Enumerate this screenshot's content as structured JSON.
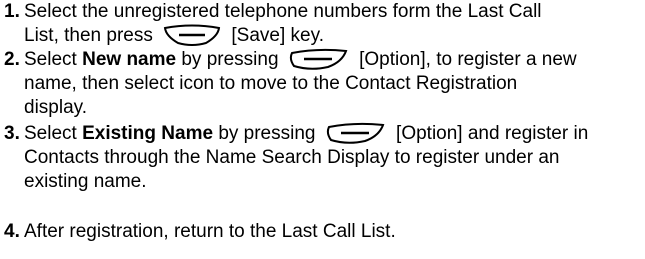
{
  "steps": [
    {
      "num": "1.",
      "l1": "Select the unregistered telephone numbers form the Last Call",
      "l2a": "List, then press",
      "l2b": "[Save] key."
    },
    {
      "num": "2.",
      "l1a": "Select",
      "l1b": "New name",
      "l1c": "by pressing",
      "l1d": "[Option], to register a new",
      "l2": "name, then select icon to move to the Contact Registration",
      "l3": "display."
    },
    {
      "num": "3.",
      "l1a": "Select",
      "l1b": "Existing Name",
      "l1c": "by pressing",
      "l1d": "[Option] and register in",
      "l2": "Contacts through the Name Search Display to register under an",
      "l3": "existing name."
    },
    {
      "num": "4.",
      "l1": "After registration, return to the Last Call List."
    }
  ],
  "icons": {
    "save": "center-softkey-icon",
    "option": "right-softkey-icon"
  }
}
